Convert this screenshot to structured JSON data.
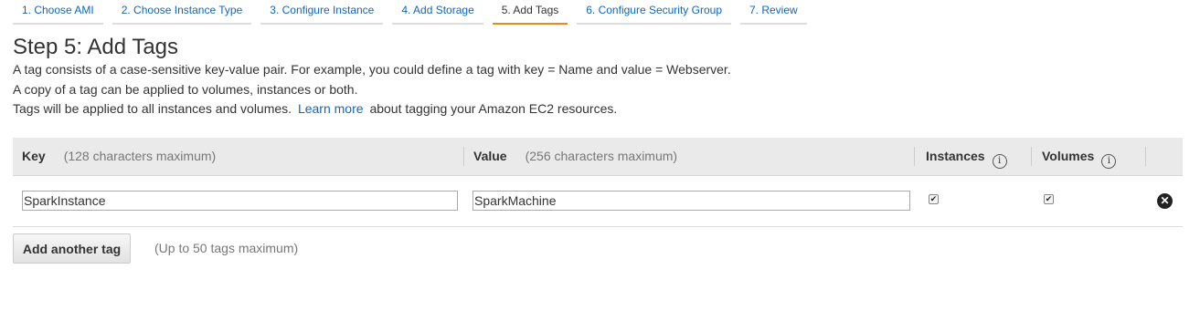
{
  "wizard": {
    "steps": [
      {
        "label": "1. Choose AMI"
      },
      {
        "label": "2. Choose Instance Type"
      },
      {
        "label": "3. Configure Instance"
      },
      {
        "label": "4. Add Storage"
      },
      {
        "label": "5. Add Tags"
      },
      {
        "label": "6. Configure Security Group"
      },
      {
        "label": "7. Review"
      }
    ],
    "active_step": "5. Add Tags"
  },
  "page": {
    "title": "Step 5: Add Tags",
    "desc_line1": "A tag consists of a case-sensitive key-value pair. For example, you could define a tag with key = Name and value = Webserver.",
    "desc_line2": "A copy of a tag can be applied to volumes, instances or both.",
    "desc_line3_pre": "Tags will be applied to all instances and volumes.",
    "desc_line3_link": "Learn more",
    "desc_line3_post": "about tagging your Amazon EC2 resources."
  },
  "table": {
    "key_header": "Key",
    "key_hint": "(128 characters maximum)",
    "value_header": "Value",
    "value_hint": "(256 characters maximum)",
    "instances_header": "Instances",
    "volumes_header": "Volumes",
    "info_glyph": "i",
    "rows": [
      {
        "key": "SparkInstance",
        "value": "SparkMachine",
        "instances": true,
        "volumes": true
      }
    ]
  },
  "actions": {
    "add_label": "Add another tag",
    "add_hint": "(Up to 50 tags maximum)"
  },
  "icons": {
    "checkbox_checked": "✔",
    "remove": "✕"
  },
  "colors": {
    "link": "#1166bb",
    "active_tab_underline": "#e88a1a",
    "header_bg": "#eaeaea"
  }
}
